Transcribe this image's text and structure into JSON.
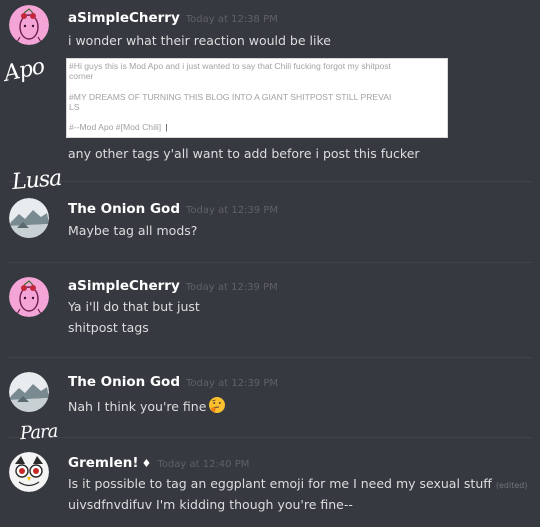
{
  "side_notes": [
    "Apo",
    "Lusa",
    "Para"
  ],
  "messages": [
    {
      "author": "aSimpleCherry",
      "timestamp": "Today at 12:38 PM",
      "lines": [
        "i wonder what their reaction would be like",
        "any other tags y'all want to add before i post this fucker"
      ],
      "embed": {
        "line1": "#Hi guys this is Mod Apo and i just wanted to say that Chili fucking forgot my shitpost",
        "line2": "corner",
        "line3": "#MY DREAMS OF TURNING THIS BLOG INTO A GIANT SHITPOST STILL PREVAI",
        "line4": "LS",
        "tags": "#--Mod Apo   #[Mod Chili]"
      }
    },
    {
      "author": "The Onion God",
      "timestamp": "Today at 12:39 PM",
      "lines": [
        "Maybe tag all mods?"
      ]
    },
    {
      "author": "aSimpleCherry",
      "timestamp": "Today at 12:39 PM",
      "lines": [
        "Ya i'll do that but just",
        "shitpost tags"
      ]
    },
    {
      "author": "The Onion God",
      "timestamp": "Today at 12:39 PM",
      "lines": [
        "Nah I think you're fine"
      ],
      "emoji": "thinking-face"
    },
    {
      "author": "Gremlen!",
      "author_badge": "♦",
      "timestamp": "Today at 12:40 PM",
      "lines": [
        "Is it possible to tag an eggplant emoji for me I need my sexual stuff",
        "uivsdfnvdifuv I'm kidding though you're fine--"
      ],
      "edited": "(edited)"
    }
  ],
  "colors": {
    "background": "#36393f",
    "username": "#ffffff",
    "message_text": "#dcddde",
    "timestamp": "#5e6166"
  }
}
